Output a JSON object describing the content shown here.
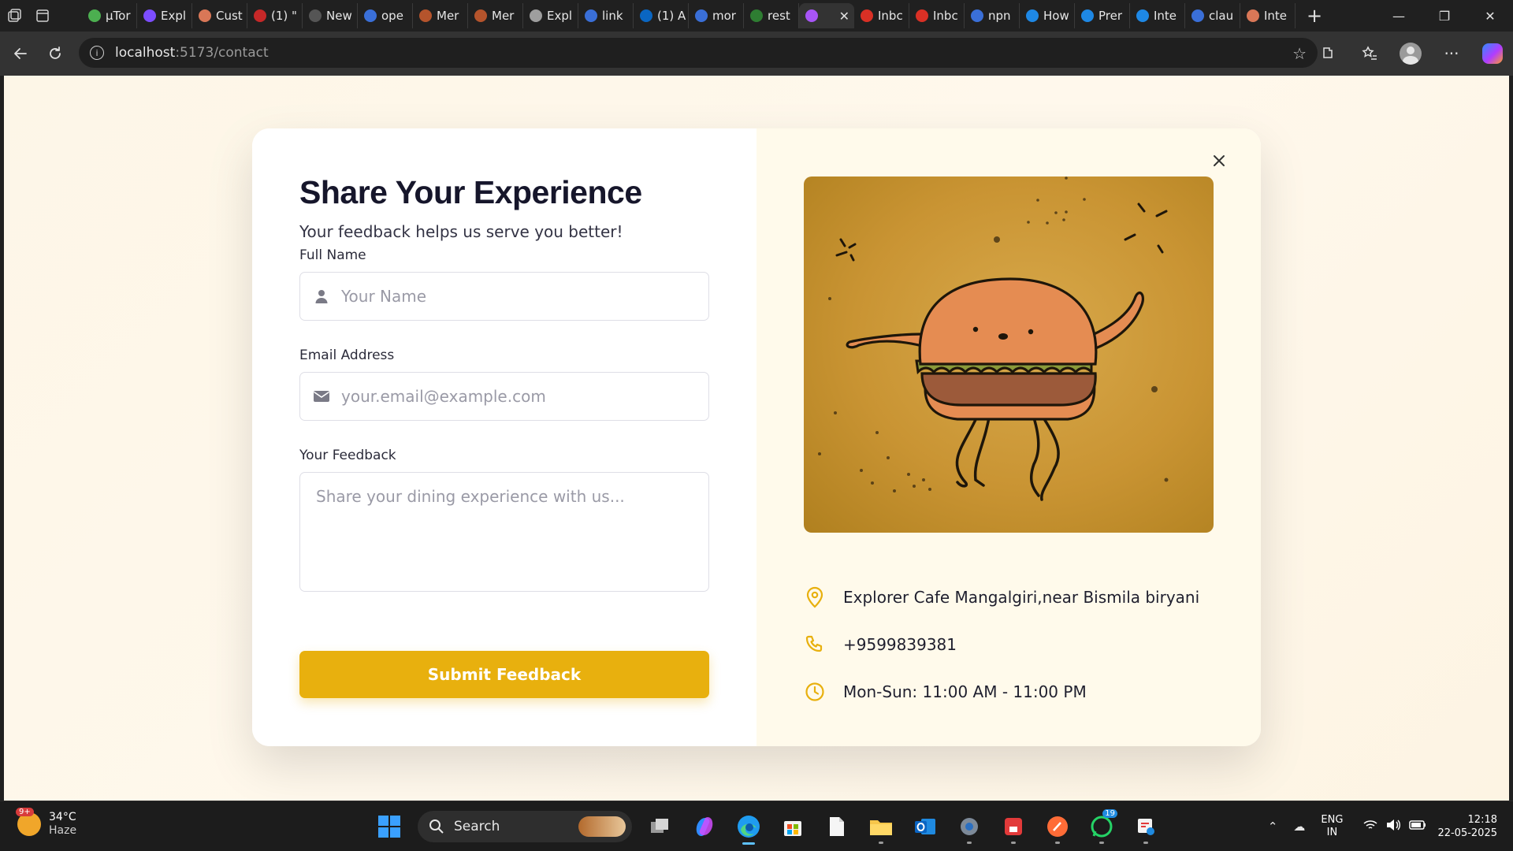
{
  "browser": {
    "tabs": [
      {
        "label": "µTor",
        "fav_color": "#4caf50"
      },
      {
        "label": "Expl",
        "fav_color": "#7c4dff"
      },
      {
        "label": "Cust",
        "fav_color": "#d97757"
      },
      {
        "label": "(1) \"",
        "fav_color": "#c62828"
      },
      {
        "label": "New",
        "fav_color": "#555555"
      },
      {
        "label": "ope",
        "fav_color": "#3a6fd8"
      },
      {
        "label": "Mer",
        "fav_color": "#b5542c"
      },
      {
        "label": "Mer",
        "fav_color": "#b5542c"
      },
      {
        "label": "Expl",
        "fav_color": "#9e9e9e"
      },
      {
        "label": "link",
        "fav_color": "#3a6fd8"
      },
      {
        "label": "(1) A",
        "fav_color": "#0a66c2"
      },
      {
        "label": "mor",
        "fav_color": "#3a6fd8"
      },
      {
        "label": "rest",
        "fav_color": "#2e7d32"
      },
      {
        "label": "",
        "fav_color": "#a855f7",
        "active": true
      },
      {
        "label": "Inbc",
        "fav_color": "#d93025"
      },
      {
        "label": "Inbc",
        "fav_color": "#d93025"
      },
      {
        "label": "npn",
        "fav_color": "#3a6fd8"
      },
      {
        "label": "How",
        "fav_color": "#1e88e5"
      },
      {
        "label": "Prer",
        "fav_color": "#1e88e5"
      },
      {
        "label": "Inte",
        "fav_color": "#1e88e5"
      },
      {
        "label": "clau",
        "fav_color": "#3a6fd8"
      },
      {
        "label": "Inte",
        "fav_color": "#d97757"
      }
    ],
    "url_host": "localhost",
    "url_path": ":5173/contact"
  },
  "form": {
    "title": "Share Your Experience",
    "subtitle": "Your feedback helps us serve you better!",
    "name_label": "Full Name",
    "name_placeholder": "Your Name",
    "email_label": "Email Address",
    "email_placeholder": "your.email@example.com",
    "feedback_label": "Your Feedback",
    "feedback_placeholder": "Share your dining experience with us...",
    "submit_label": "Submit Feedback"
  },
  "info": {
    "address": "Explorer Cafe Mangalgiri,near Bismila biryani",
    "phone": "+9599839381",
    "hours": "Mon-Sun: 11:00 AM - 11:00 PM"
  },
  "colors": {
    "accent": "#e8b00e",
    "panel_bg": "#fffaeb"
  },
  "taskbar": {
    "weather_badge": "9+",
    "temperature": "34°C",
    "condition": "Haze",
    "search_label": "Search",
    "whatsapp_badge": "19",
    "lang_top": "ENG",
    "lang_bottom": "IN",
    "time": "12:18",
    "date": "22-05-2025"
  }
}
